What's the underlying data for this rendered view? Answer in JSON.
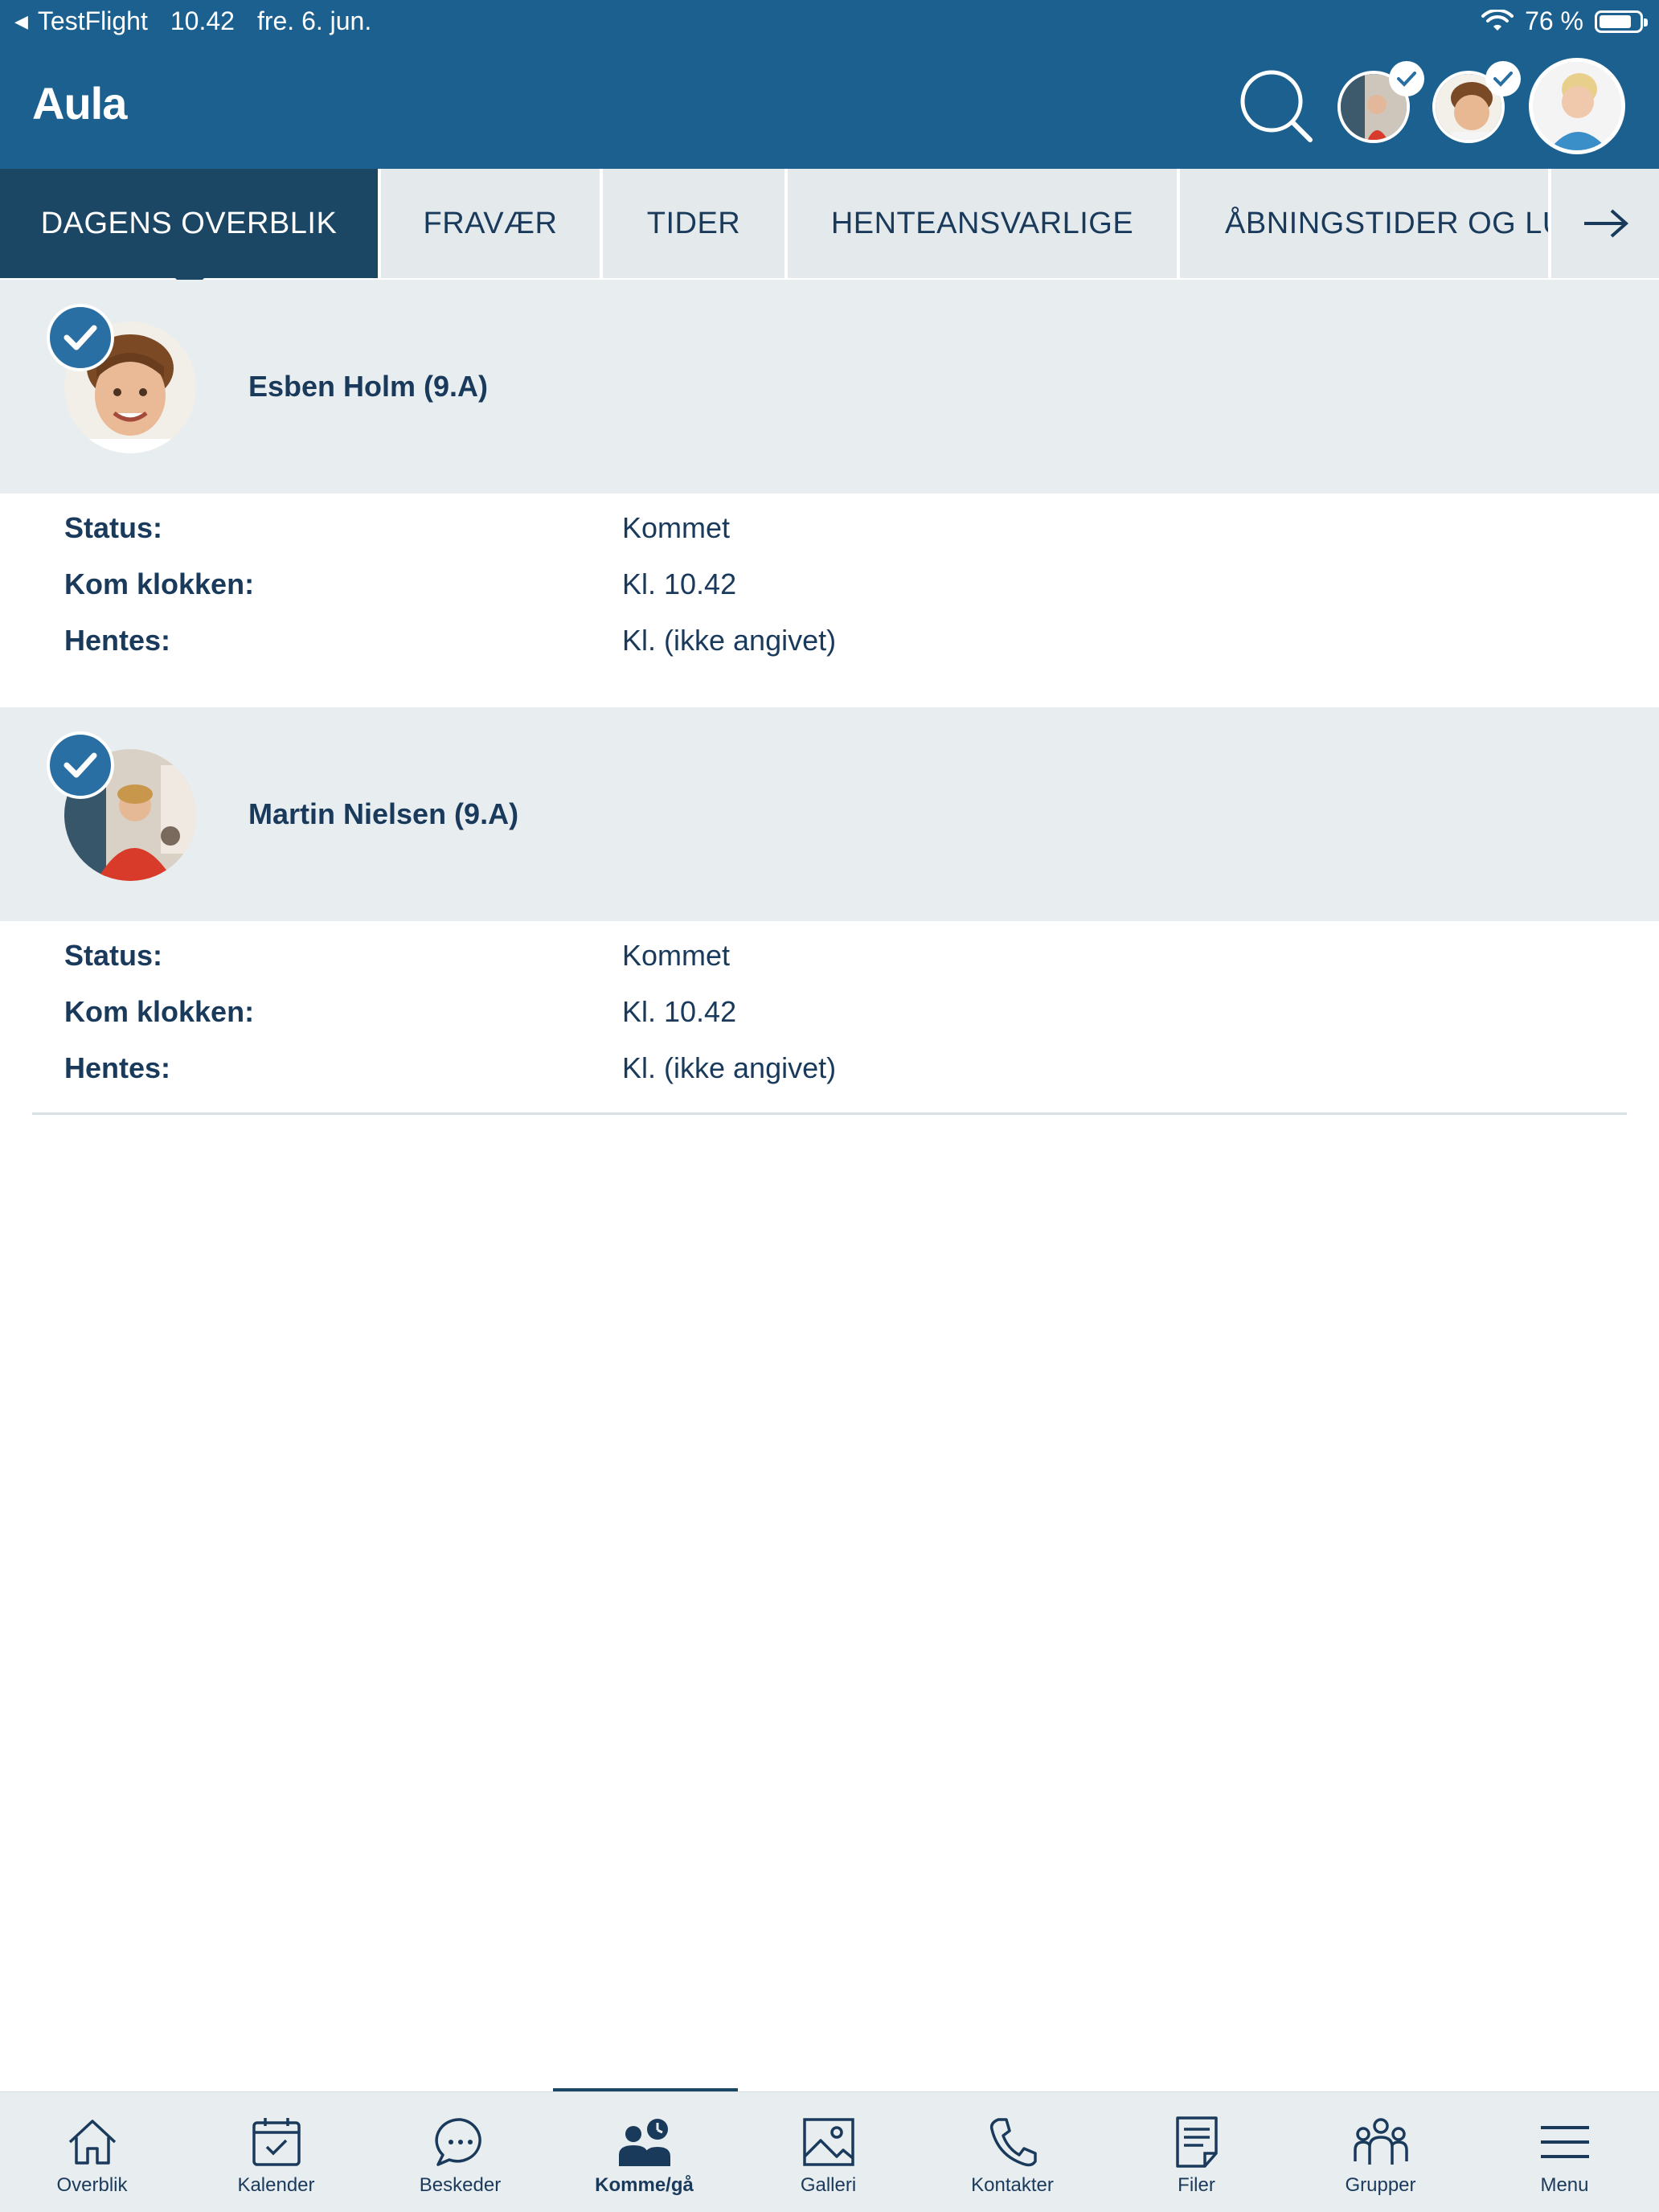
{
  "status_bar": {
    "back_app": "TestFlight",
    "time": "10.42",
    "date": "fre. 6. jun.",
    "battery": "76 %"
  },
  "header": {
    "logo": "Aula",
    "search_icon": "search-icon"
  },
  "tabs": [
    {
      "label": "DAGENS OVERBLIK",
      "active": true
    },
    {
      "label": "FRAVÆR",
      "active": false
    },
    {
      "label": "TIDER",
      "active": false
    },
    {
      "label": "HENTEANSVARLIGE",
      "active": false
    },
    {
      "label": "ÅBNINGSTIDER OG LU",
      "active": false
    }
  ],
  "children": [
    {
      "name": "Esben Holm (9.A)",
      "rows": [
        {
          "label": "Status:",
          "value": "Kommet"
        },
        {
          "label": "Kom klokken:",
          "value": "Kl. 10.42"
        },
        {
          "label": "Hentes:",
          "value": "Kl. (ikke angivet)"
        }
      ]
    },
    {
      "name": "Martin Nielsen (9.A)",
      "rows": [
        {
          "label": "Status:",
          "value": "Kommet"
        },
        {
          "label": "Kom klokken:",
          "value": "Kl. 10.42"
        },
        {
          "label": "Hentes:",
          "value": "Kl. (ikke angivet)"
        }
      ]
    }
  ],
  "bottom_nav": [
    {
      "label": "Overblik",
      "icon": "home-icon"
    },
    {
      "label": "Kalender",
      "icon": "calendar-icon"
    },
    {
      "label": "Beskeder",
      "icon": "chat-icon"
    },
    {
      "label": "Komme/gå",
      "icon": "people-clock-icon",
      "active": true
    },
    {
      "label": "Galleri",
      "icon": "image-icon"
    },
    {
      "label": "Kontakter",
      "icon": "phone-icon"
    },
    {
      "label": "Filer",
      "icon": "document-icon"
    },
    {
      "label": "Grupper",
      "icon": "group-icon"
    },
    {
      "label": "Menu",
      "icon": "menu-icon"
    }
  ],
  "colors": {
    "header": "#1c6090",
    "active_tab": "#1b4765",
    "tab_bg": "#e4e9ec",
    "card_bg": "#e8edf0",
    "check": "#2a6fa3",
    "text": "#1a3a5c"
  }
}
